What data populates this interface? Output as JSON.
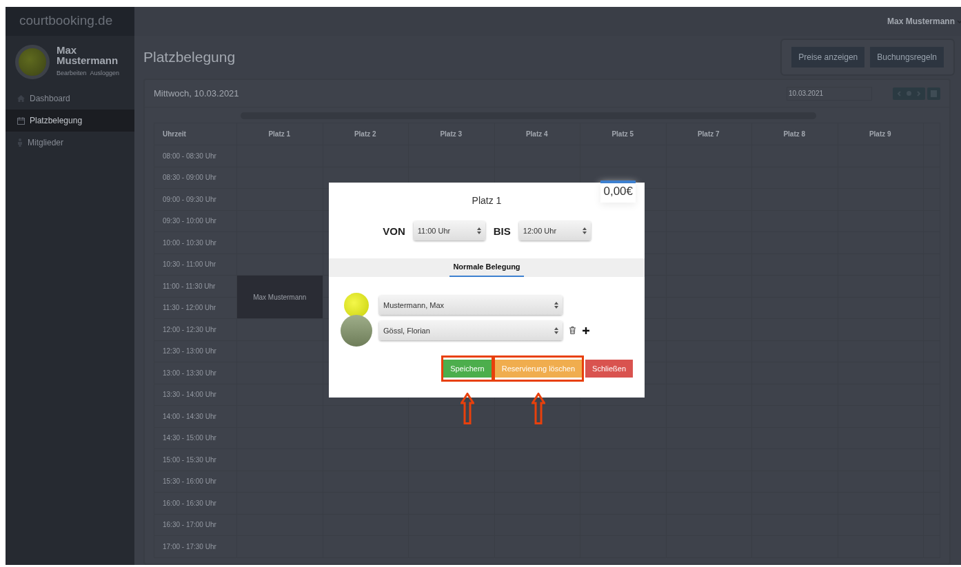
{
  "brand": "courtbooking.de",
  "user_menu": {
    "label": "Max Mustermann"
  },
  "profile": {
    "name": "Max Mustermann",
    "links": [
      "Bearbeiten",
      "Ausloggen"
    ]
  },
  "sidebar": {
    "items": [
      {
        "label": "Dashboard",
        "selected": false
      },
      {
        "label": "Platzbelegung",
        "selected": true
      },
      {
        "label": "Mitglieder",
        "selected": false
      }
    ]
  },
  "page_title": "Platzbelegung",
  "header_buttons": [
    "Preise anzeigen",
    "Buchungsregeln"
  ],
  "card": {
    "date_heading": "Mittwoch, 10.03.2021",
    "date_field": "10.03.2021"
  },
  "table": {
    "columns": [
      "Uhrzeit",
      "Platz 1",
      "Platz 2",
      "Platz 3",
      "Platz 4",
      "Platz 5",
      "Platz 7",
      "Platz 8",
      "Platz 9"
    ],
    "rows": [
      {
        "time": "08:00 - 08:30 Uhr",
        "booked": [
          false,
          false,
          false,
          false,
          false,
          false,
          false,
          false
        ]
      },
      {
        "time": "08:30 - 09:00 Uhr",
        "booked": [
          false,
          false,
          false,
          false,
          false,
          false,
          false,
          false
        ]
      },
      {
        "time": "09:00 - 09:30 Uhr",
        "booked": [
          false,
          false,
          false,
          false,
          false,
          false,
          false,
          false
        ]
      },
      {
        "time": "09:30 - 10:00 Uhr",
        "booked": [
          false,
          false,
          false,
          false,
          false,
          false,
          false,
          false
        ]
      },
      {
        "time": "10:00 - 10:30 Uhr",
        "booked": [
          false,
          false,
          false,
          false,
          false,
          false,
          false,
          false
        ]
      },
      {
        "time": "10:30 - 11:00 Uhr",
        "booked": [
          false,
          false,
          false,
          false,
          false,
          false,
          false,
          false
        ]
      },
      {
        "time": "11:00 - 11:30 Uhr",
        "booked": [
          true,
          false,
          false,
          false,
          false,
          false,
          false,
          false
        ],
        "booking_name": "Max Mustermann"
      },
      {
        "time": "11:30 - 12:00 Uhr",
        "booked": [
          true,
          false,
          false,
          false,
          false,
          false,
          false,
          false
        ]
      },
      {
        "time": "12:00 - 12:30 Uhr",
        "booked": [
          false,
          false,
          false,
          false,
          false,
          false,
          false,
          false
        ]
      },
      {
        "time": "12:30 - 13:00 Uhr",
        "booked": [
          false,
          false,
          false,
          false,
          false,
          false,
          false,
          false
        ]
      },
      {
        "time": "13:00 - 13:30 Uhr",
        "booked": [
          false,
          false,
          false,
          false,
          false,
          false,
          false,
          false
        ]
      },
      {
        "time": "13:30 - 14:00 Uhr",
        "booked": [
          false,
          false,
          false,
          false,
          false,
          false,
          false,
          false
        ]
      },
      {
        "time": "14:00 - 14:30 Uhr",
        "booked": [
          false,
          false,
          false,
          false,
          false,
          false,
          false,
          false
        ]
      },
      {
        "time": "14:30 - 15:00 Uhr",
        "booked": [
          false,
          false,
          false,
          false,
          false,
          false,
          false,
          false
        ]
      },
      {
        "time": "15:00 - 15:30 Uhr",
        "booked": [
          false,
          false,
          false,
          false,
          false,
          false,
          false,
          false
        ]
      },
      {
        "time": "15:30 - 16:00 Uhr",
        "booked": [
          false,
          false,
          false,
          false,
          false,
          false,
          false,
          false
        ]
      },
      {
        "time": "16:00 - 16:30 Uhr",
        "booked": [
          false,
          false,
          false,
          false,
          false,
          false,
          false,
          false
        ]
      },
      {
        "time": "16:30 - 17:00 Uhr",
        "booked": [
          false,
          false,
          false,
          false,
          false,
          false,
          false,
          false
        ]
      },
      {
        "time": "17:00 - 17:30 Uhr",
        "booked": [
          false,
          false,
          false,
          false,
          false,
          false,
          false,
          false
        ]
      }
    ]
  },
  "modal": {
    "title": "Platz 1",
    "price": "0,00€",
    "from_label": "VON",
    "from_value": "11:00 Uhr",
    "to_label": "BIS",
    "to_value": "12:00 Uhr",
    "tabs": [
      {
        "label": "Normale Belegung",
        "selected": true
      }
    ],
    "players": [
      {
        "kind": "ball",
        "value": "Mustermann, Max",
        "removable": false
      },
      {
        "kind": "photo",
        "value": "Gössl, Florian",
        "removable": true
      }
    ],
    "buttons": [
      {
        "label": "Speichern",
        "kind": "success",
        "highlighted": true
      },
      {
        "label": "Reservierung löschen",
        "kind": "warning",
        "highlighted": true
      },
      {
        "label": "Schließen",
        "kind": "danger",
        "highlighted": false
      }
    ]
  }
}
